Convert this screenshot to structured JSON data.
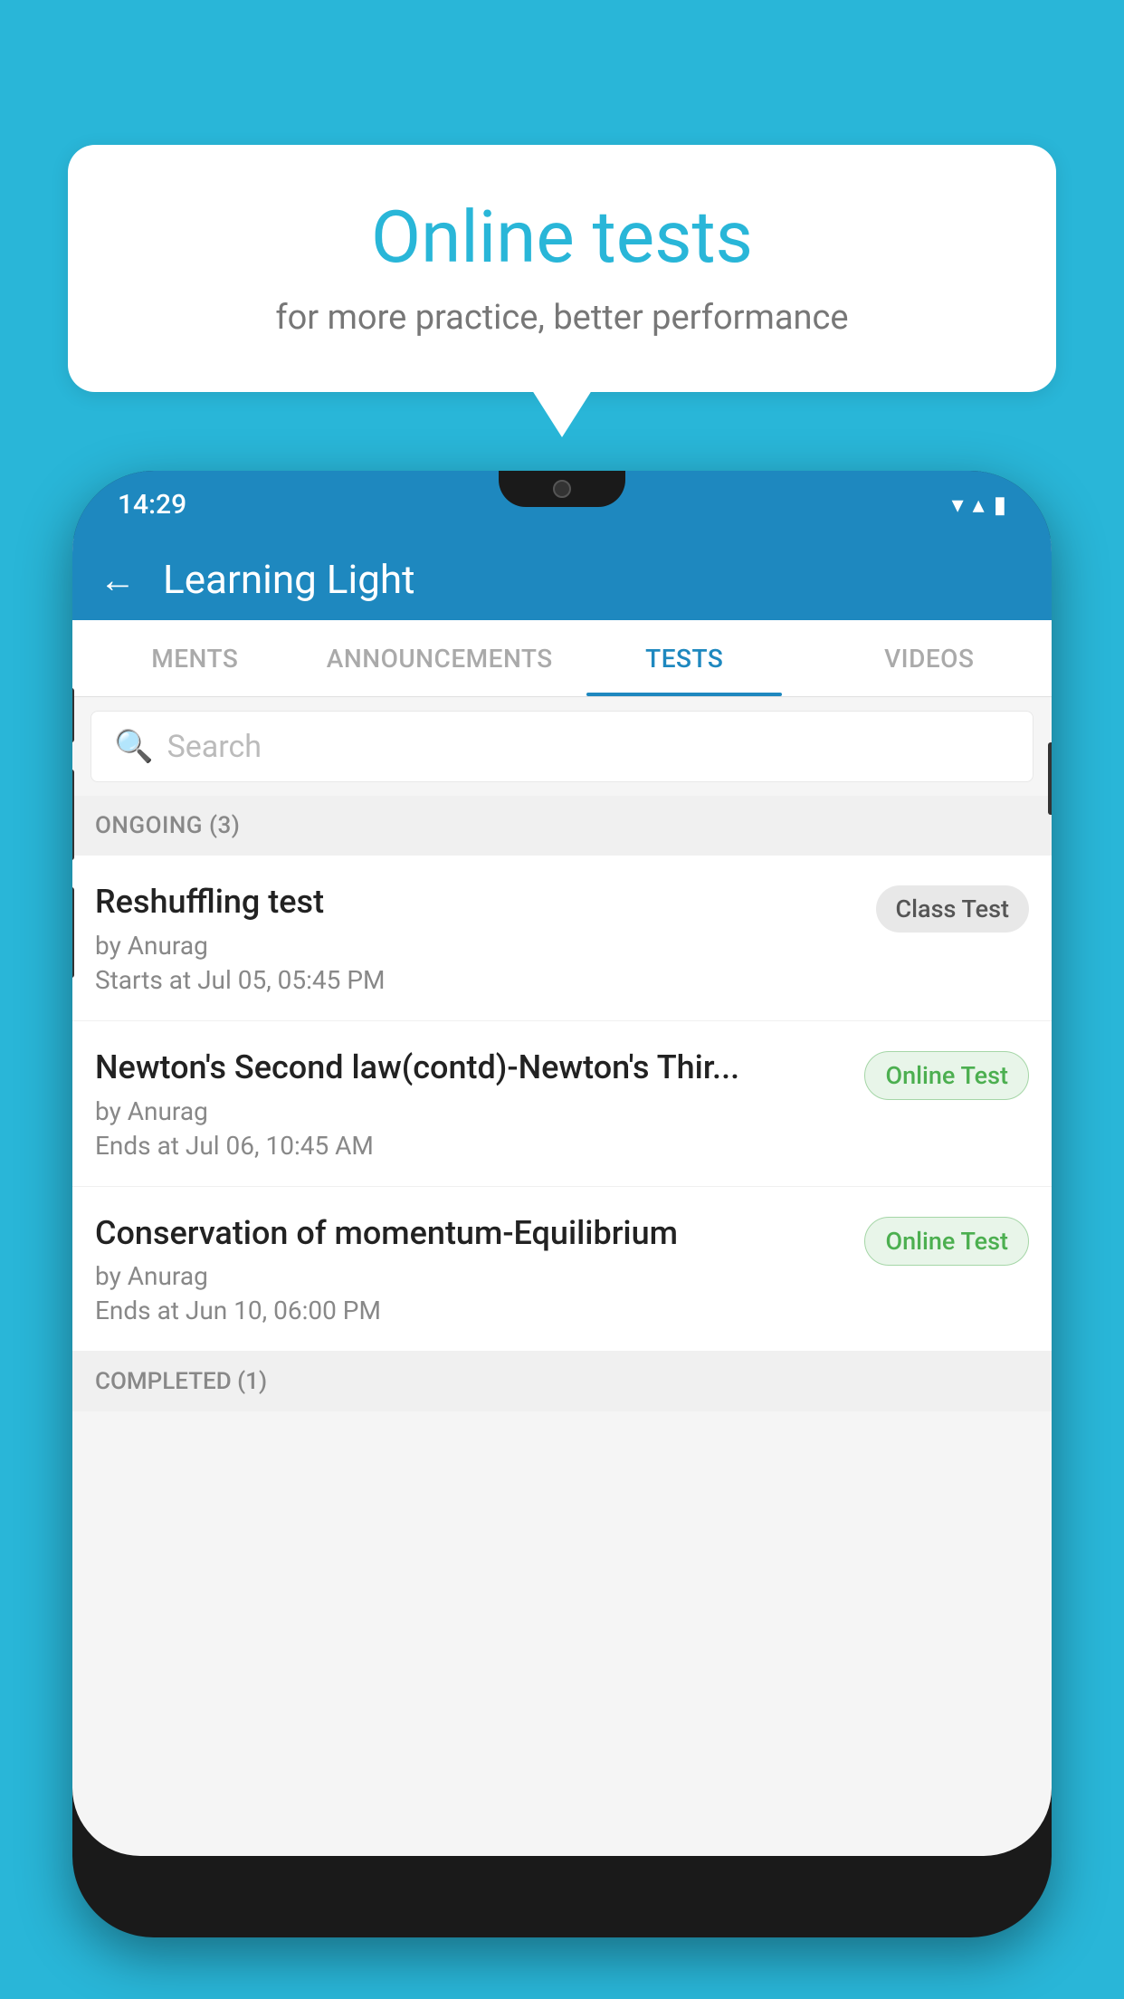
{
  "bubble": {
    "title": "Online tests",
    "subtitle": "for more practice, better performance"
  },
  "phone": {
    "status_bar": {
      "time": "14:29",
      "wifi_icon": "▼",
      "signal_icon": "▲",
      "battery_icon": "▮"
    },
    "header": {
      "back_label": "←",
      "app_name": "Learning Light"
    },
    "tabs": [
      {
        "label": "MENTS",
        "active": false
      },
      {
        "label": "ANNOUNCEMENTS",
        "active": false
      },
      {
        "label": "TESTS",
        "active": true
      },
      {
        "label": "VIDEOS",
        "active": false
      }
    ],
    "search": {
      "placeholder": "Search"
    },
    "sections": [
      {
        "label": "ONGOING (3)",
        "items": [
          {
            "name": "Reshuffling test",
            "by": "by Anurag",
            "date": "Starts at  Jul 05, 05:45 PM",
            "badge": "Class Test",
            "badge_type": "class"
          },
          {
            "name": "Newton's Second law(contd)-Newton's Thir...",
            "by": "by Anurag",
            "date": "Ends at  Jul 06, 10:45 AM",
            "badge": "Online Test",
            "badge_type": "online"
          },
          {
            "name": "Conservation of momentum-Equilibrium",
            "by": "by Anurag",
            "date": "Ends at  Jun 10, 06:00 PM",
            "badge": "Online Test",
            "badge_type": "online"
          }
        ]
      }
    ],
    "completed_label": "COMPLETED (1)"
  }
}
